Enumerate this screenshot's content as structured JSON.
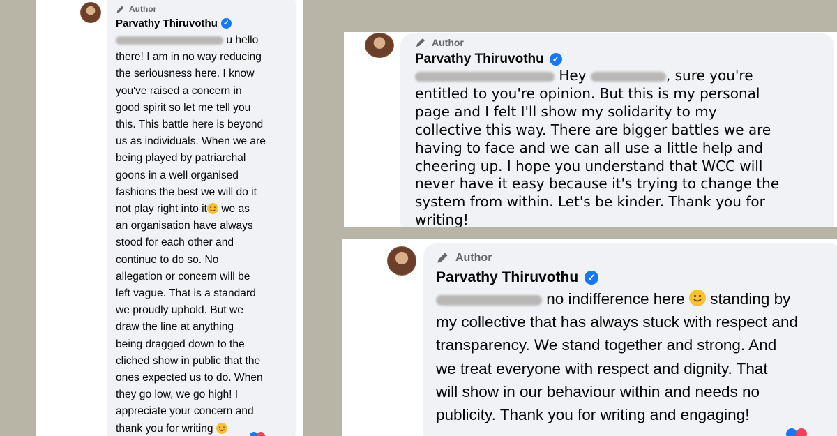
{
  "comments": [
    {
      "author_tag": "Author",
      "name": "Parvathy Thiruvothu",
      "text_after_blur": "u hello",
      "lines": [
        "there! I am in no way reducing",
        "the seriousness here. I know",
        "you've raised a concern in",
        "good spirit so let me tell you",
        "this. This battle here is beyond",
        "us as individuals. When we are",
        "being played by patriarchal",
        "goons in a well organised",
        "fashions the best we will do it",
        "not play right into it",
        " we as",
        "an organisation have always",
        "stood for each other and",
        "continue to do so. No",
        "allegation or concern will be",
        "left vague. That is a standard",
        "we proudly uphold. But we",
        "draw the line at anything",
        "being dragged down to the",
        "cliched show in public that the",
        "ones expected us to do. When",
        "they go low, we go high! I",
        "appreciate your concern and",
        "thank you for writing"
      ]
    },
    {
      "author_tag": "Author",
      "name": "Parvathy Thiruvothu",
      "line1_a": "Hey",
      "line1_b": ", sure you're",
      "lines": [
        "entitled to you're opinion. But this is my personal",
        "page and I felt I'll show my solidarity to my",
        "collective this way. There are bigger battles we are",
        "having to face and we can all use a little help and",
        "cheering up. I hope you understand that WCC will",
        "never have it easy because it's trying to change the",
        "system from within. Let's be kinder. Thank you for",
        "writing!"
      ]
    },
    {
      "author_tag": "Author",
      "name": "Parvathy Thiruvothu",
      "line1_a": "no indifference here",
      "line1_b": "standing by",
      "lines": [
        "my collective that has always stuck with respect and",
        "transparency. We stand together and strong. And",
        "we treat everyone with respect and dignity. That",
        "will show in our behaviour within and needs no",
        "publicity. Thank you for writing and engaging!"
      ]
    }
  ],
  "icons": {
    "author": "pencil-icon",
    "verified": "verified-badge-icon",
    "emoji_smile": "smiling-face-icon",
    "emoji_blush": "blushing-face-icon"
  },
  "colors": {
    "background": "#b8b4a6",
    "bubble": "#f0f2f5",
    "verified": "#1877f2",
    "muted": "#65676b"
  }
}
